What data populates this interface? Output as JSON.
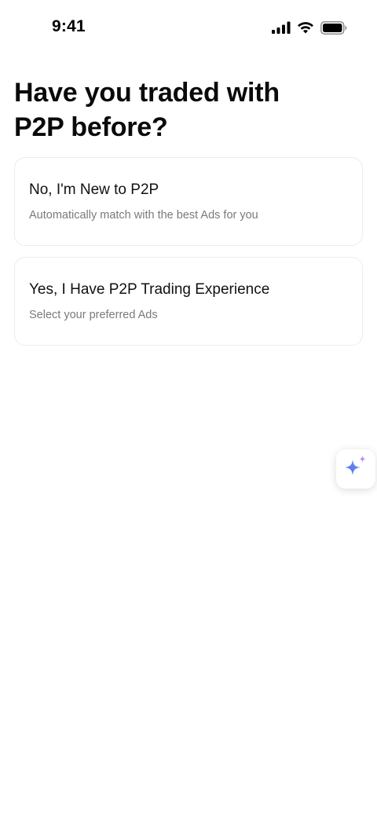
{
  "status_bar": {
    "time": "9:41",
    "icons": [
      "cellular-signal-icon",
      "wifi-icon",
      "battery-icon"
    ]
  },
  "page": {
    "title": "Have you traded with P2P before?"
  },
  "options": [
    {
      "title": "No, I'm New to P2P",
      "subtitle": "Automatically match with the best Ads for you"
    },
    {
      "title": "Yes, I Have P2P Trading Experience",
      "subtitle": "Select your preferred Ads"
    }
  ],
  "ai_button": {
    "icon": "sparkle-icon"
  },
  "colors": {
    "background": "#ffffff",
    "text_primary": "#0b0b0b",
    "text_secondary": "#7a7a7a",
    "card_border": "#ececec",
    "sparkle_blue": "#4f7df0",
    "sparkle_purple": "#b48cf2"
  }
}
